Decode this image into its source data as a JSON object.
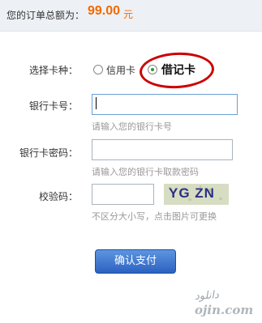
{
  "header": {
    "order_label": "您的订单总额为：",
    "amount": "99.00",
    "unit": "元"
  },
  "card_type": {
    "label": "选择卡种：",
    "options": [
      {
        "label": "信用卡",
        "selected": false
      },
      {
        "label": "借记卡",
        "selected": true
      }
    ]
  },
  "card_number": {
    "label": "银行卡号：",
    "value": "",
    "hint": "请输入您的银行卡号"
  },
  "card_password": {
    "label": "银行卡密码：",
    "value": "",
    "hint": "请输入您的银行卡取款密码"
  },
  "captcha": {
    "label": "校验码：",
    "value": "",
    "image_text": "YG ZN",
    "hint": "不区分大小写，点击图片可更换"
  },
  "submit_label": "确认支付",
  "watermark": {
    "text": "دانلود",
    "domain": "ojin.com"
  },
  "colors": {
    "amount": "#f26a00",
    "highlight": "#cc0000",
    "button": "#2c62c1",
    "radio_checked": "#2e9a2e"
  }
}
